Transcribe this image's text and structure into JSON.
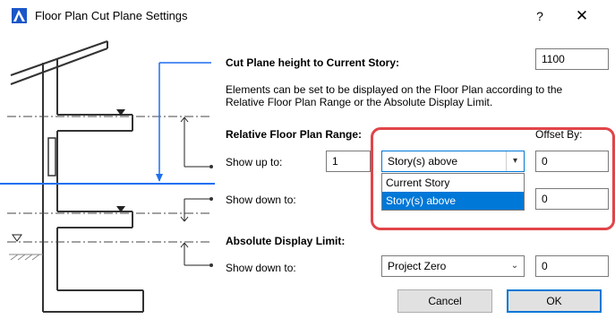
{
  "window": {
    "title": "Floor Plan Cut Plane Settings",
    "help_label": "?",
    "close_label": "✕"
  },
  "cut_plane": {
    "label": "Cut Plane height to Current Story:",
    "value": "1100"
  },
  "description": {
    "line1": "Elements can be set to be displayed on the Floor Plan according to the",
    "line2": "Relative Floor Plan Range or the Absolute Display Limit."
  },
  "relative_range": {
    "header": "Relative Floor Plan Range:",
    "offset_header": "Offset By:",
    "show_up_label": "Show up to:",
    "show_up_count": "1",
    "show_up_select": "Story(s) above",
    "show_up_offset": "0",
    "dropdown_options": [
      "Current Story",
      "Story(s) above"
    ],
    "dropdown_selected": "Story(s) above",
    "show_down_label": "Show down to:",
    "show_down_offset": "0"
  },
  "absolute_limit": {
    "header": "Absolute Display Limit:",
    "show_down_label": "Show down to:",
    "select": "Project Zero",
    "offset": "0"
  },
  "buttons": {
    "cancel": "Cancel",
    "ok": "OK"
  },
  "colors": {
    "accent": "#0078d7",
    "illustration_blue": "#1e6ff0",
    "highlight": "#e0454a"
  }
}
